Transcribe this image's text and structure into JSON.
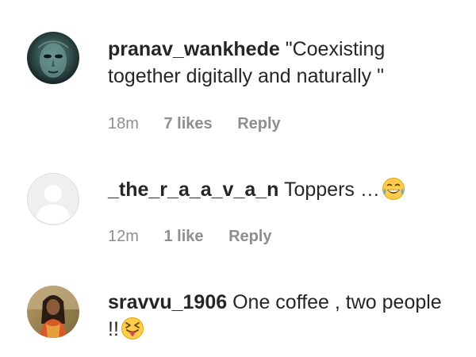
{
  "comments": [
    {
      "username": "pranav_wankhede",
      "text": "\"Coexisting together digitally and naturally \"",
      "time": "18m",
      "likes": "7 likes",
      "reply": "Reply",
      "avatar_icon": "dark-teal-face-avatar-icon"
    },
    {
      "username": "_the_r_a_a_v_a_n",
      "text": "Toppers …",
      "emoji": "tears-of-joy-emoji-icon",
      "time": "12m",
      "likes": "1 like",
      "reply": "Reply",
      "avatar_icon": "default-profile-avatar-icon"
    },
    {
      "username": "sravvu_1906",
      "text": "One coffee , two people !!",
      "emoji": "squinting-tongue-emoji-icon",
      "time": "",
      "likes": "",
      "reply": "",
      "avatar_icon": "woman-portrait-avatar-icon"
    }
  ],
  "colors": {
    "text": "#262626",
    "meta": "#8e8e8e",
    "default_avatar_bg": "#efefef",
    "emoji_yellow": "#ffcc4d"
  }
}
